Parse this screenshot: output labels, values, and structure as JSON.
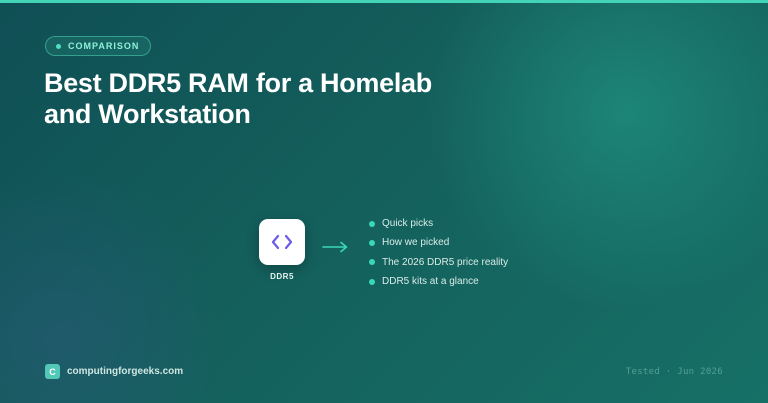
{
  "badge": {
    "label": "COMPARISON"
  },
  "title": "Best DDR5 RAM for a Homelab and Workstation",
  "tile": {
    "icon": "code-brackets-icon",
    "label": "DDR5"
  },
  "toc": [
    {
      "label": "Quick picks"
    },
    {
      "label": "How we picked"
    },
    {
      "label": "The 2026 DDR5 price reality"
    },
    {
      "label": "DDR5 kits at a glance"
    }
  ],
  "footer": {
    "logo_letter": "C",
    "site": "computingforgeeks.com",
    "tested": "Tested · Jun 2026"
  },
  "colors": {
    "accent": "#43d3b6",
    "background": "#135b57",
    "icon": "#6a5ce8"
  }
}
